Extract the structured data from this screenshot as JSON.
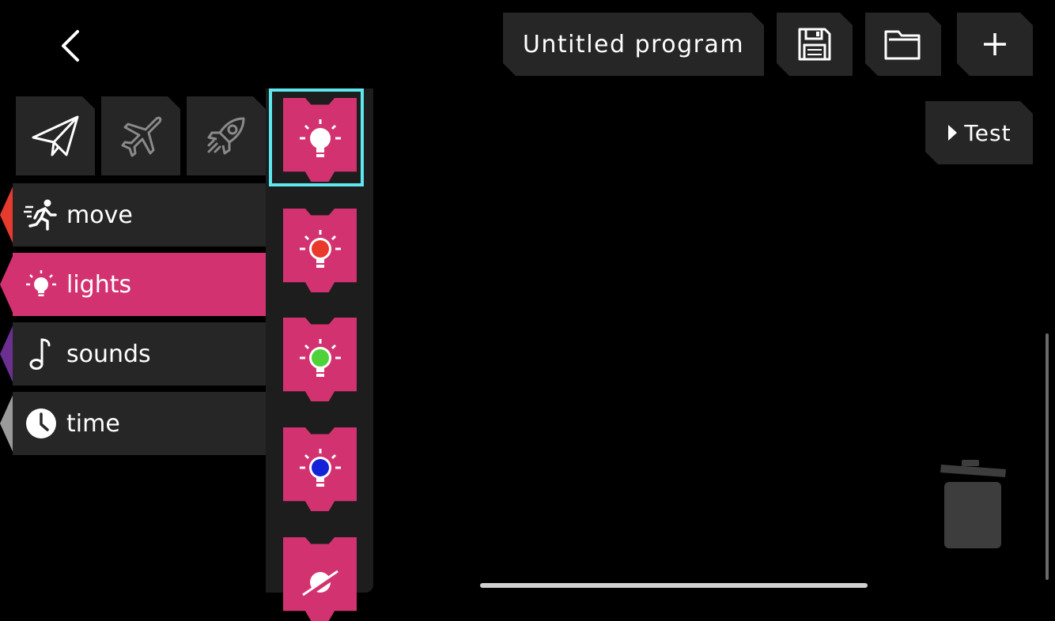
{
  "header": {
    "back_icon": "chevron-left-icon",
    "program_title": "Untitled program",
    "save_icon": "floppy-disk-icon",
    "open_icon": "folder-icon",
    "new_icon": "plus-icon"
  },
  "test_button": {
    "label": "Test",
    "icon": "play-triangle-icon"
  },
  "devices": [
    {
      "icon": "paper-plane-icon",
      "selected": true
    },
    {
      "icon": "airplane-icon",
      "selected": false
    },
    {
      "icon": "rocket-icon",
      "selected": false
    }
  ],
  "categories": [
    {
      "label": "move",
      "icon": "running-person-icon",
      "color": "#e53a2e",
      "selected": false
    },
    {
      "label": "lights",
      "icon": "lightbulb-icon",
      "color": "#d33271",
      "selected": true
    },
    {
      "label": "sounds",
      "icon": "music-note-icon",
      "color": "#6a2f8f",
      "selected": false
    },
    {
      "label": "time",
      "icon": "clock-icon",
      "color": "#9a9a9a",
      "selected": false
    }
  ],
  "palette_blocks": [
    {
      "icon": "lightbulb-white-icon",
      "bulb_color": "#ffffff",
      "selected": true
    },
    {
      "icon": "lightbulb-red-icon",
      "bulb_color": "#e8392b",
      "selected": false
    },
    {
      "icon": "lightbulb-green-icon",
      "bulb_color": "#4fd13a",
      "selected": false
    },
    {
      "icon": "lightbulb-blue-icon",
      "bulb_color": "#1522d8",
      "selected": false
    },
    {
      "icon": "lightbulb-off-icon",
      "bulb_color": "#ffffff",
      "selected": false
    }
  ],
  "colors": {
    "accent_pink": "#d33271",
    "selection_cyan": "#5de7ee",
    "chip_bg": "#262626"
  },
  "trash_icon": "trash-can-icon"
}
